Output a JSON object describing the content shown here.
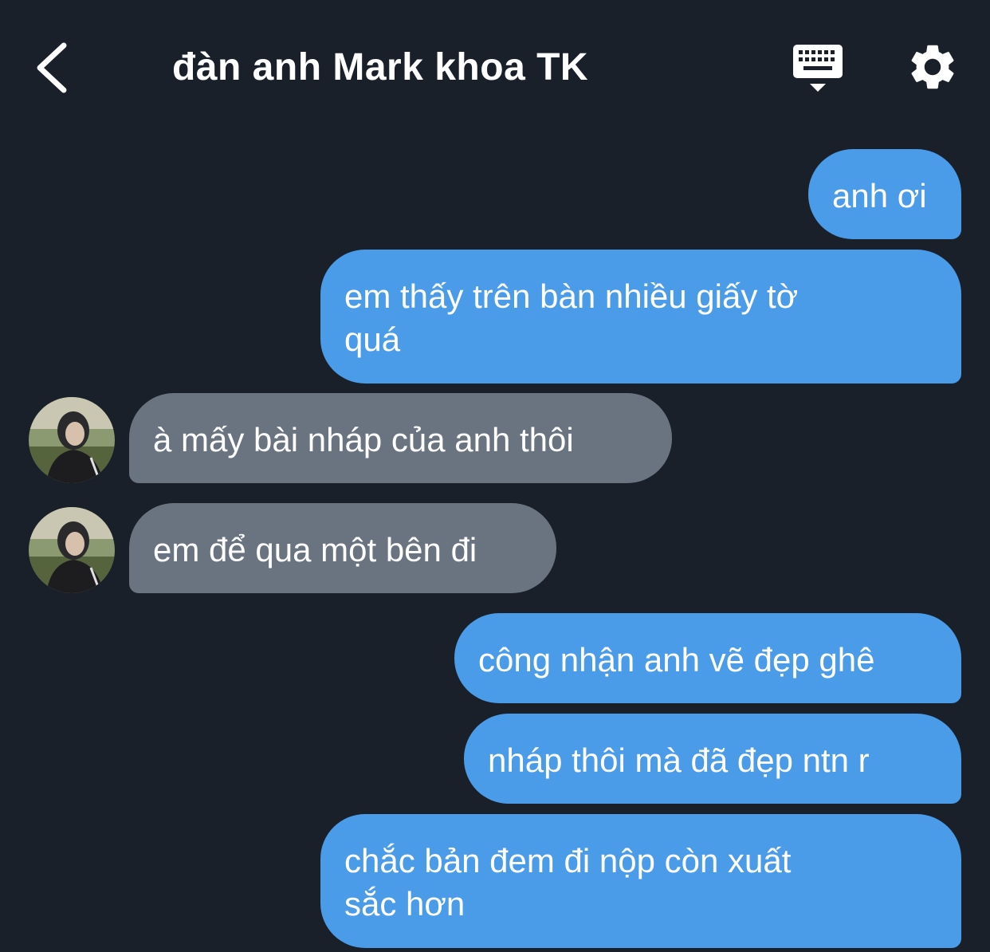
{
  "header": {
    "title": "đàn anh Mark khoa TK",
    "back_icon": "chevron-left-icon",
    "keyboard_icon": "keyboard-icon",
    "settings_icon": "gear-icon"
  },
  "colors": {
    "background": "#19202a",
    "outgoing_bubble": "#4a9be8",
    "incoming_bubble": "#6a7480",
    "text": "#ffffff"
  },
  "messages": [
    {
      "side": "outgoing",
      "text": "anh ơi"
    },
    {
      "side": "outgoing",
      "text": "em thấy trên bàn nhiều giấy tờ\nquá"
    },
    {
      "side": "incoming",
      "text": "à mấy bài nháp của anh thôi"
    },
    {
      "side": "incoming",
      "text": "em để qua một bên đi"
    },
    {
      "side": "outgoing",
      "text": "công nhận anh vẽ đẹp ghê"
    },
    {
      "side": "outgoing",
      "text": "nháp thôi mà đã đẹp ntn r"
    },
    {
      "side": "outgoing",
      "text": "chắc bản đem đi nộp còn xuất\nsắc hơn"
    }
  ]
}
